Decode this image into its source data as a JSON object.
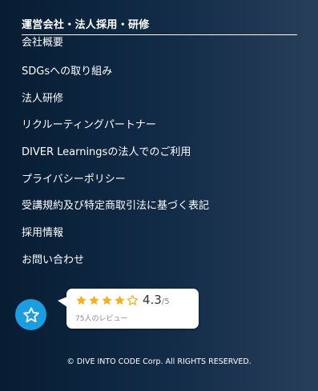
{
  "section": {
    "title": "運営会社・法人採用・研修"
  },
  "menu": {
    "items": [
      "会社概要",
      "SDGsへの取り組み",
      "法人研修",
      "リクルーティングパートナー",
      "DIVER Learningsの法人でのご利用",
      "プライバシーポリシー",
      "受講規約及び特定商取引法に基づく表記",
      "採用情報",
      "お問い合わせ"
    ]
  },
  "rating_widget": {
    "icon": "star-outline-icon",
    "badge_color": "#1a9ee0",
    "star_color": "#f3b11b",
    "stars": 4.5,
    "score": "4.3",
    "max": "/5",
    "count_label": "75人のレビュー"
  },
  "footer": {
    "copyright": "© DIVE INTO CODE Corp. All RIGHTS RESERVED."
  }
}
